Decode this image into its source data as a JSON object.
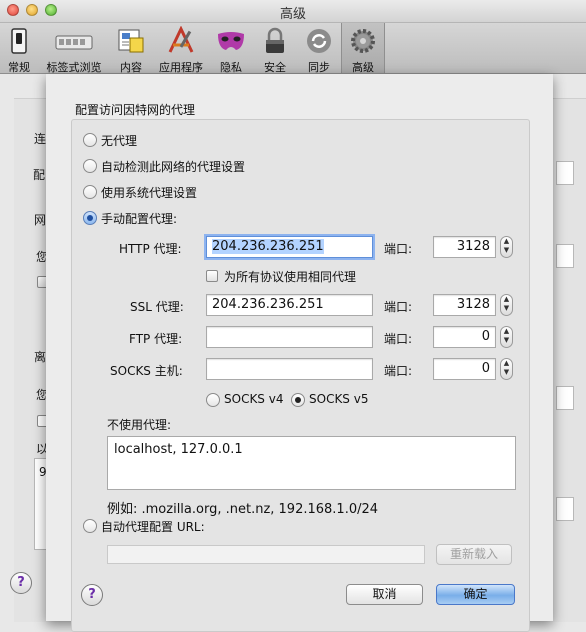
{
  "window": {
    "title": "高级"
  },
  "toolbar": {
    "items": [
      {
        "label": "常规",
        "icon": "general-switch-icon"
      },
      {
        "label": "标签式浏览",
        "icon": "tabs-icon"
      },
      {
        "label": "内容",
        "icon": "content-icon"
      },
      {
        "label": "应用程序",
        "icon": "applications-icon"
      },
      {
        "label": "隐私",
        "icon": "privacy-mask-icon"
      },
      {
        "label": "安全",
        "icon": "padlock-icon"
      },
      {
        "label": "同步",
        "icon": "sync-icon"
      },
      {
        "label": "高级",
        "icon": "gear-icon"
      }
    ],
    "active": "高级"
  },
  "background": {
    "label_conn": "连",
    "label_cfg": "配",
    "label_net": "网",
    "label_you1": "您",
    "label_offline": "离",
    "label_you2": "您",
    "label_yi": "以",
    "label_9": "9"
  },
  "dialog": {
    "heading": "配置访问因特网的代理",
    "options": {
      "no_proxy": "无代理",
      "auto_detect": "自动检测此网络的代理设置",
      "system": "使用系统代理设置",
      "manual": "手动配置代理:"
    },
    "selected": "manual",
    "http": {
      "label": "HTTP 代理:",
      "value": "204.236.236.251",
      "port_label": "端口:",
      "port": "3128"
    },
    "same_proxy_label": "为所有协议使用相同代理",
    "ssl": {
      "label": "SSL 代理:",
      "value": "204.236.236.251",
      "port_label": "端口:",
      "port": "3128"
    },
    "ftp": {
      "label": "FTP 代理:",
      "value": "",
      "port_label": "端口:",
      "port": "0"
    },
    "socks": {
      "label": "SOCKS 主机:",
      "value": "",
      "port_label": "端口:",
      "port": "0"
    },
    "socks_v4": "SOCKS v4",
    "socks_v5": "SOCKS v5",
    "socks_selected": "v5",
    "no_proxy_for_label": "不使用代理:",
    "no_proxy_for_value": "localhost, 127.0.0.1",
    "example": "例如: .mozilla.org, .net.nz, 192.168.1.0/24",
    "auto_config_label": "自动代理配置 URL:",
    "auto_config_value": "",
    "reload_button": "重新载入",
    "help": "?",
    "cancel_button": "取消",
    "ok_button": "确定"
  },
  "colors": {
    "accent": "#5f8fd9",
    "default_button": "#79aee9",
    "help_question": "#6b2ea8"
  }
}
